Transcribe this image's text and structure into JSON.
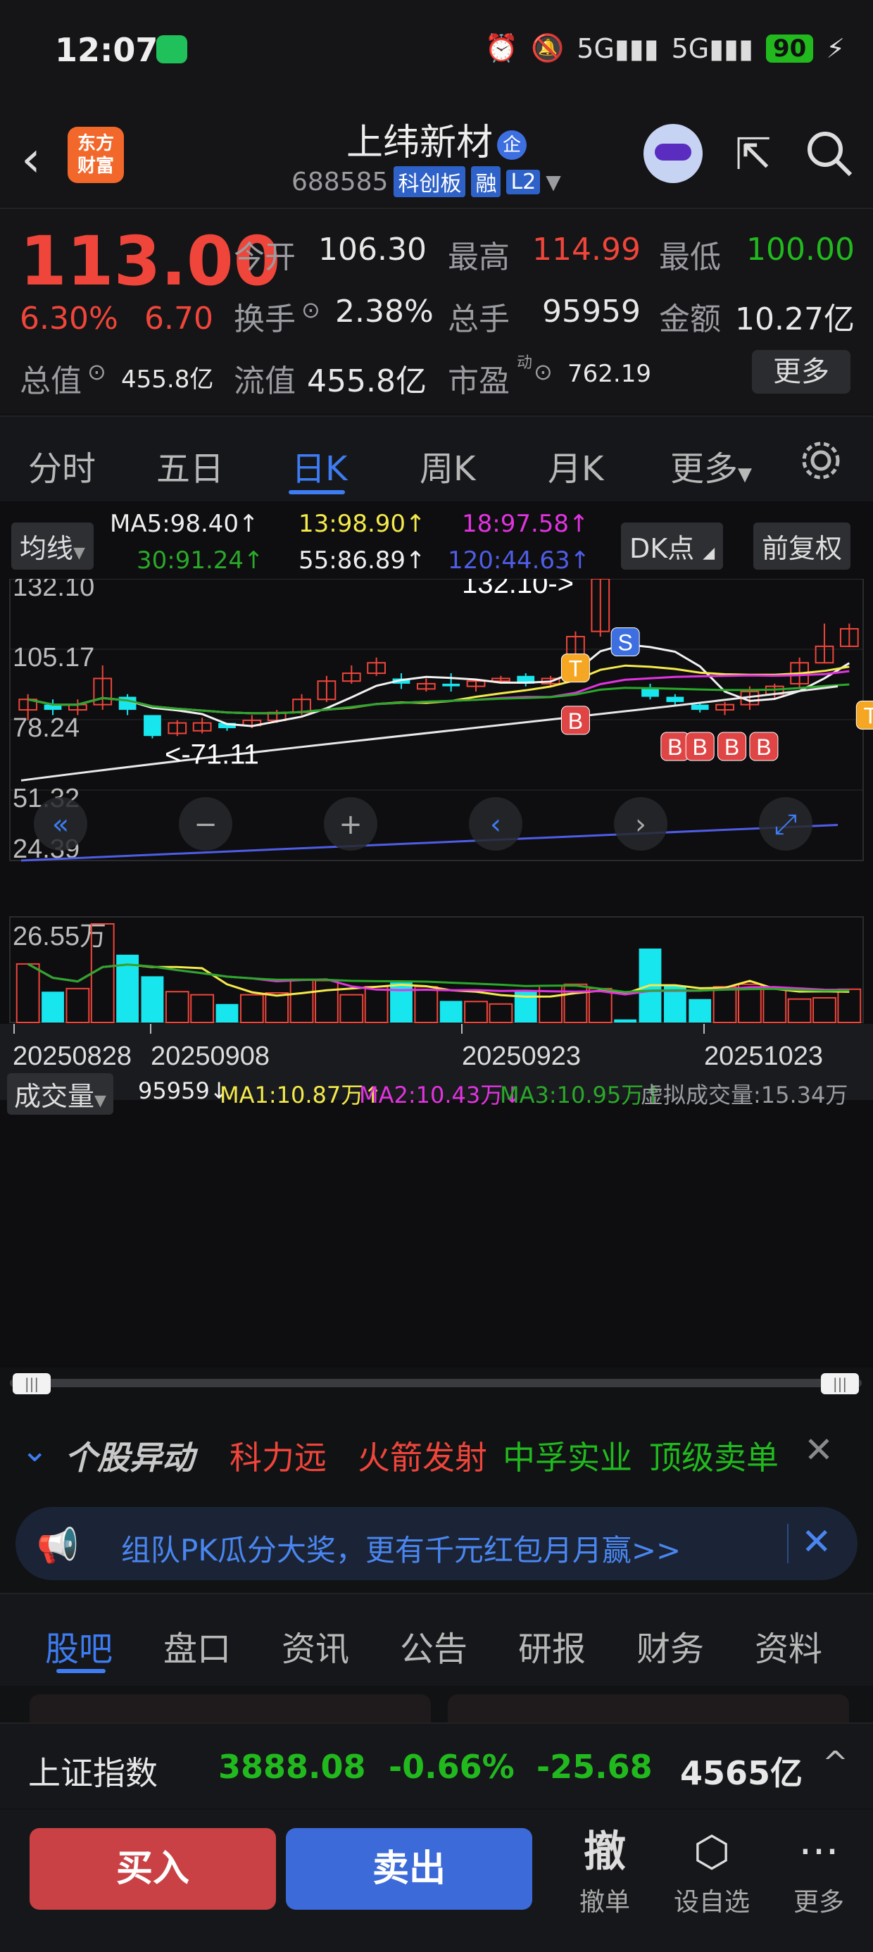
{
  "status_bar": {
    "time": "12:07",
    "network": "5G",
    "battery": "90"
  },
  "header": {
    "title": "上纬新材",
    "badge": "企",
    "code": "688585",
    "tags": [
      "科创板",
      "融",
      "L2"
    ],
    "logo_line1": "东方",
    "logo_line2": "财富"
  },
  "quote": {
    "price": "113.00",
    "change_pct": "6.30%",
    "change": "6.70",
    "open_label": "今开",
    "open": "106.30",
    "high_label": "最高",
    "high": "114.99",
    "low_label": "最低",
    "low": "100.00",
    "turnover_label": "换手",
    "turnover": "2.38%",
    "volume_label": "总手",
    "volume": "95959",
    "amount_label": "金额",
    "amount": "10.27亿",
    "mktcap_label": "总值",
    "mktcap": "455.8亿",
    "float_label": "流值",
    "float_cap": "455.8亿",
    "pe_label": "市盈",
    "pe_sup": "动",
    "pe": "762.19",
    "more": "更多"
  },
  "tabs": {
    "items": [
      "分时",
      "五日",
      "日K",
      "周K",
      "月K",
      "更多"
    ],
    "active": "日K"
  },
  "chart_controls": {
    "ma_toggle": "均线",
    "dk": "DK点",
    "adjust": "前复权",
    "ma5": "MA5:98.40↑",
    "ma13": "13:98.90↑",
    "ma18": "18:97.58↑",
    "ma30": "30:91.24↑",
    "ma55": "55:86.89↑",
    "ma120": "120:44.63↑"
  },
  "volume_controls": {
    "label": "成交量",
    "vol": "95959↓",
    "ma1": "MA1:10.87万↑",
    "ma2": "MA2:10.43万↓",
    "ma3": "MA3:10.95万↑",
    "virtual": "虚拟成交量:15.34万",
    "top_label": "26.55万"
  },
  "chart_data": {
    "type": "candlestick",
    "y_ticks": [
      "132.10",
      "105.17",
      "78.24",
      "51.32",
      "24.39"
    ],
    "ylim": [
      24.39,
      132.1
    ],
    "annotations": {
      "high": "132.10->",
      "low": "<-71.11"
    },
    "markers": [
      "S",
      "T",
      "B",
      "B",
      "B",
      "B",
      "B",
      "T"
    ],
    "x_labels": [
      "20250828",
      "20250908",
      "20250923",
      "20251023"
    ],
    "candles": [
      {
        "o": 82,
        "c": 86,
        "h": 88,
        "l": 78,
        "up": true
      },
      {
        "o": 84,
        "c": 82,
        "h": 86,
        "l": 80,
        "up": false
      },
      {
        "o": 82,
        "c": 84,
        "h": 86,
        "l": 80,
        "up": true
      },
      {
        "o": 84,
        "c": 94,
        "h": 99,
        "l": 82,
        "up": true
      },
      {
        "o": 87,
        "c": 82,
        "h": 88,
        "l": 80,
        "up": false
      },
      {
        "o": 80,
        "c": 72,
        "h": 80,
        "l": 71.11,
        "up": false
      },
      {
        "o": 73,
        "c": 77,
        "h": 78,
        "l": 72,
        "up": true
      },
      {
        "o": 74,
        "c": 77,
        "h": 79,
        "l": 73,
        "up": true
      },
      {
        "o": 77,
        "c": 75,
        "h": 77,
        "l": 74,
        "up": false
      },
      {
        "o": 76,
        "c": 78,
        "h": 80,
        "l": 75,
        "up": true
      },
      {
        "o": 78,
        "c": 81,
        "h": 82,
        "l": 77,
        "up": true
      },
      {
        "o": 81,
        "c": 86,
        "h": 88,
        "l": 80,
        "up": true
      },
      {
        "o": 86,
        "c": 93,
        "h": 95,
        "l": 85,
        "up": true
      },
      {
        "o": 93,
        "c": 96,
        "h": 99,
        "l": 92,
        "up": true
      },
      {
        "o": 96,
        "c": 100,
        "h": 102,
        "l": 95,
        "up": true
      },
      {
        "o": 94,
        "c": 92,
        "h": 96,
        "l": 90,
        "up": false
      },
      {
        "o": 90,
        "c": 92,
        "h": 94,
        "l": 89,
        "up": true
      },
      {
        "o": 92,
        "c": 91,
        "h": 96,
        "l": 89,
        "up": false
      },
      {
        "o": 91,
        "c": 93,
        "h": 94,
        "l": 89,
        "up": true
      },
      {
        "o": 93,
        "c": 94,
        "h": 95,
        "l": 92,
        "up": true
      },
      {
        "o": 95,
        "c": 92,
        "h": 96,
        "l": 91,
        "up": false
      },
      {
        "o": 92,
        "c": 94,
        "h": 95,
        "l": 91,
        "up": true
      },
      {
        "o": 100,
        "c": 110,
        "h": 112,
        "l": 98,
        "up": true
      },
      {
        "o": 112,
        "c": 132.1,
        "h": 132.1,
        "l": 110,
        "up": true
      },
      {
        "o": 107,
        "c": 107,
        "h": 108,
        "l": 106,
        "up": false
      },
      {
        "o": 90,
        "c": 87,
        "h": 92,
        "l": 86,
        "up": false
      },
      {
        "o": 87,
        "c": 85,
        "h": 88,
        "l": 84,
        "up": false
      },
      {
        "o": 84,
        "c": 82,
        "h": 85,
        "l": 81,
        "up": false
      },
      {
        "o": 82,
        "c": 84,
        "h": 85,
        "l": 80,
        "up": true
      },
      {
        "o": 84,
        "c": 89,
        "h": 91,
        "l": 82,
        "up": true
      },
      {
        "o": 88,
        "c": 91,
        "h": 92,
        "l": 86,
        "up": true
      },
      {
        "o": 92,
        "c": 100,
        "h": 102,
        "l": 90,
        "up": true
      },
      {
        "o": 100,
        "c": 106.3,
        "h": 114.99,
        "l": 100,
        "up": true
      },
      {
        "o": 106.3,
        "c": 113,
        "h": 114.99,
        "l": 106,
        "up": true
      }
    ],
    "volume": [
      95,
      50,
      55,
      160,
      110,
      75,
      50,
      45,
      30,
      45,
      48,
      70,
      68,
      45,
      58,
      65,
      58,
      35,
      34,
      30,
      52,
      60,
      62,
      55,
      5,
      120,
      60,
      38,
      58,
      62,
      55,
      38,
      40,
      54
    ],
    "volume_max": 26.55
  },
  "anomaly": {
    "label": "个股异动",
    "items": [
      {
        "text": "科力远",
        "color": "red"
      },
      {
        "text": "火箭发射",
        "color": "red"
      },
      {
        "text": "中孚实业",
        "color": "green"
      },
      {
        "text": "顶级卖单",
        "color": "green"
      }
    ]
  },
  "banner": {
    "text": "组队PK瓜分大奖，更有千元红包月月赢>>"
  },
  "sub_tabs": {
    "items": [
      "股吧",
      "盘口",
      "资讯",
      "公告",
      "研报",
      "财务",
      "资料"
    ],
    "active": "股吧"
  },
  "index": {
    "name": "上证指数",
    "value": "3888.08",
    "pct": "-0.66%",
    "change": "-25.68",
    "amount": "4565亿"
  },
  "bottom": {
    "buy": "买入",
    "sell": "卖出",
    "cancel_icon": "撤",
    "cancel": "撤单",
    "watch": "设自选",
    "more": "更多"
  }
}
